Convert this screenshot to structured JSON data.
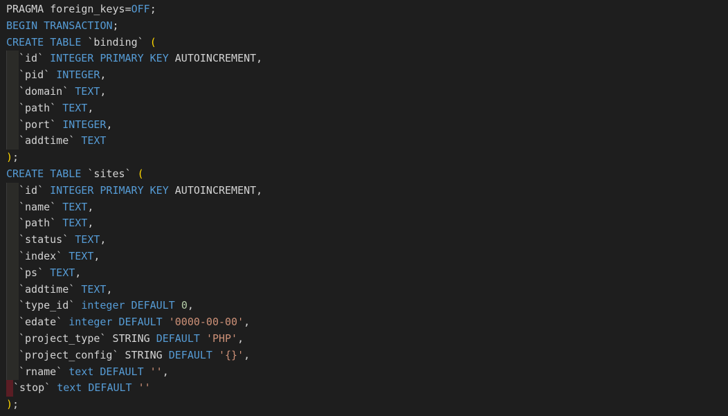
{
  "editor": {
    "lines": [
      {
        "guide": "none",
        "tokens": [
          {
            "c": "plain",
            "t": "PRAGMA foreign_keys="
          },
          {
            "c": "kw",
            "t": "OFF"
          },
          {
            "c": "punct",
            "t": ";"
          }
        ]
      },
      {
        "guide": "none",
        "tokens": [
          {
            "c": "kw",
            "t": "BEGIN TRANSACTION"
          },
          {
            "c": "punct",
            "t": ";"
          }
        ]
      },
      {
        "guide": "none",
        "tokens": [
          {
            "c": "kw",
            "t": "CREATE TABLE "
          },
          {
            "c": "ident",
            "t": "`binding`"
          },
          {
            "c": "punct",
            "t": " "
          },
          {
            "c": "paren",
            "t": "("
          }
        ]
      },
      {
        "guide": "indent",
        "tokens": [
          {
            "c": "ident",
            "t": "`id`"
          },
          {
            "c": "punct",
            "t": " "
          },
          {
            "c": "kw",
            "t": "INTEGER PRIMARY KEY"
          },
          {
            "c": "plain",
            "t": " AUTOINCREMENT,"
          }
        ]
      },
      {
        "guide": "indent",
        "tokens": [
          {
            "c": "ident",
            "t": "`pid`"
          },
          {
            "c": "punct",
            "t": " "
          },
          {
            "c": "kw",
            "t": "INTEGER"
          },
          {
            "c": "punct",
            "t": ","
          }
        ]
      },
      {
        "guide": "indent",
        "tokens": [
          {
            "c": "ident",
            "t": "`domain`"
          },
          {
            "c": "punct",
            "t": " "
          },
          {
            "c": "kw",
            "t": "TEXT"
          },
          {
            "c": "punct",
            "t": ","
          }
        ]
      },
      {
        "guide": "indent",
        "tokens": [
          {
            "c": "ident",
            "t": "`path`"
          },
          {
            "c": "punct",
            "t": " "
          },
          {
            "c": "kw",
            "t": "TEXT"
          },
          {
            "c": "punct",
            "t": ","
          }
        ]
      },
      {
        "guide": "indent",
        "tokens": [
          {
            "c": "ident",
            "t": "`port`"
          },
          {
            "c": "punct",
            "t": " "
          },
          {
            "c": "kw",
            "t": "INTEGER"
          },
          {
            "c": "punct",
            "t": ","
          }
        ]
      },
      {
        "guide": "indent",
        "tokens": [
          {
            "c": "ident",
            "t": "`addtime`"
          },
          {
            "c": "punct",
            "t": " "
          },
          {
            "c": "kw",
            "t": "TEXT"
          }
        ]
      },
      {
        "guide": "none",
        "tokens": [
          {
            "c": "paren",
            "t": ")"
          },
          {
            "c": "punct",
            "t": ";"
          }
        ]
      },
      {
        "guide": "none",
        "tokens": [
          {
            "c": "kw",
            "t": "CREATE TABLE "
          },
          {
            "c": "ident",
            "t": "`sites`"
          },
          {
            "c": "punct",
            "t": " "
          },
          {
            "c": "paren",
            "t": "("
          }
        ]
      },
      {
        "guide": "indent",
        "tokens": [
          {
            "c": "ident",
            "t": "`id`"
          },
          {
            "c": "punct",
            "t": " "
          },
          {
            "c": "kw",
            "t": "INTEGER PRIMARY KEY"
          },
          {
            "c": "plain",
            "t": " AUTOINCREMENT,"
          }
        ]
      },
      {
        "guide": "indent",
        "tokens": [
          {
            "c": "ident",
            "t": "`name`"
          },
          {
            "c": "punct",
            "t": " "
          },
          {
            "c": "kw",
            "t": "TEXT"
          },
          {
            "c": "punct",
            "t": ","
          }
        ]
      },
      {
        "guide": "indent",
        "tokens": [
          {
            "c": "ident",
            "t": "`path`"
          },
          {
            "c": "punct",
            "t": " "
          },
          {
            "c": "kw",
            "t": "TEXT"
          },
          {
            "c": "punct",
            "t": ","
          }
        ]
      },
      {
        "guide": "indent",
        "tokens": [
          {
            "c": "ident",
            "t": "`status`"
          },
          {
            "c": "punct",
            "t": " "
          },
          {
            "c": "kw",
            "t": "TEXT"
          },
          {
            "c": "punct",
            "t": ","
          }
        ]
      },
      {
        "guide": "indent",
        "tokens": [
          {
            "c": "ident",
            "t": "`index`"
          },
          {
            "c": "punct",
            "t": " "
          },
          {
            "c": "kw",
            "t": "TEXT"
          },
          {
            "c": "punct",
            "t": ","
          }
        ]
      },
      {
        "guide": "indent",
        "tokens": [
          {
            "c": "ident",
            "t": "`ps`"
          },
          {
            "c": "punct",
            "t": " "
          },
          {
            "c": "kw",
            "t": "TEXT"
          },
          {
            "c": "punct",
            "t": ","
          }
        ]
      },
      {
        "guide": "indent",
        "tokens": [
          {
            "c": "ident",
            "t": "`addtime`"
          },
          {
            "c": "punct",
            "t": " "
          },
          {
            "c": "kw",
            "t": "TEXT"
          },
          {
            "c": "punct",
            "t": ","
          }
        ]
      },
      {
        "guide": "indent",
        "tokens": [
          {
            "c": "ident",
            "t": "`type_id`"
          },
          {
            "c": "punct",
            "t": " "
          },
          {
            "c": "kw",
            "t": "integer DEFAULT"
          },
          {
            "c": "punct",
            "t": " "
          },
          {
            "c": "num",
            "t": "0"
          },
          {
            "c": "punct",
            "t": ","
          }
        ]
      },
      {
        "guide": "indent",
        "tokens": [
          {
            "c": "ident",
            "t": "`edate`"
          },
          {
            "c": "punct",
            "t": " "
          },
          {
            "c": "kw",
            "t": "integer DEFAULT"
          },
          {
            "c": "punct",
            "t": " "
          },
          {
            "c": "str",
            "t": "'0000-00-00'"
          },
          {
            "c": "punct",
            "t": ","
          }
        ]
      },
      {
        "guide": "indent",
        "tokens": [
          {
            "c": "ident",
            "t": "`project_type`"
          },
          {
            "c": "plain",
            "t": " STRING "
          },
          {
            "c": "kw",
            "t": "DEFAULT"
          },
          {
            "c": "punct",
            "t": " "
          },
          {
            "c": "str",
            "t": "'PHP'"
          },
          {
            "c": "punct",
            "t": ","
          }
        ]
      },
      {
        "guide": "indent",
        "tokens": [
          {
            "c": "ident",
            "t": "`project_config`"
          },
          {
            "c": "plain",
            "t": " STRING "
          },
          {
            "c": "kw",
            "t": "DEFAULT"
          },
          {
            "c": "punct",
            "t": " "
          },
          {
            "c": "str",
            "t": "'{}'"
          },
          {
            "c": "punct",
            "t": ","
          }
        ]
      },
      {
        "guide": "indent",
        "tokens": [
          {
            "c": "ident",
            "t": "`rname`"
          },
          {
            "c": "punct",
            "t": " "
          },
          {
            "c": "kw",
            "t": "text DEFAULT"
          },
          {
            "c": "punct",
            "t": " "
          },
          {
            "c": "str",
            "t": "''"
          },
          {
            "c": "punct",
            "t": ","
          }
        ]
      },
      {
        "guide": "error",
        "tokens": [
          {
            "c": "ident",
            "t": "`stop`"
          },
          {
            "c": "punct",
            "t": " "
          },
          {
            "c": "kw",
            "t": "text DEFAULT"
          },
          {
            "c": "punct",
            "t": " "
          },
          {
            "c": "str",
            "t": "''"
          }
        ]
      },
      {
        "guide": "none",
        "tokens": [
          {
            "c": "paren",
            "t": ")"
          },
          {
            "c": "punct",
            "t": ";"
          }
        ]
      }
    ]
  },
  "colors": {
    "background": "#1e1e1e",
    "keyword": "#569cd6",
    "identifier": "#d4d4d4",
    "number": "#b5cea8",
    "string": "#ce9178",
    "bracket": "#ffd700",
    "error_marker": "#5a1d24"
  }
}
